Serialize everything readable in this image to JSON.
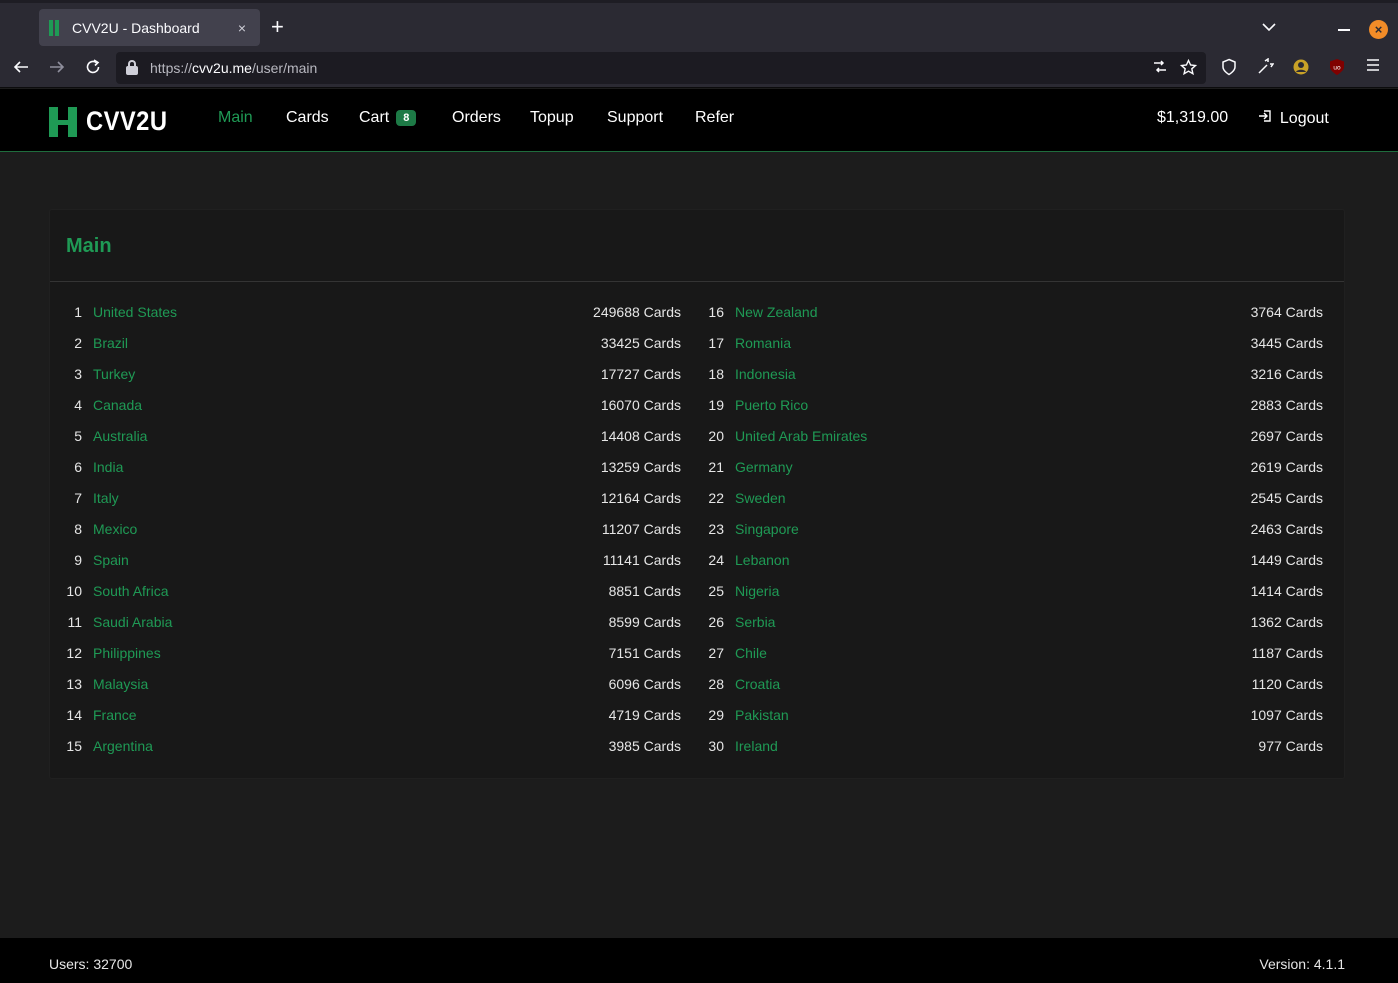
{
  "browser": {
    "tab_title": "CVV2U - Dashboard",
    "tab_close": "×",
    "new_tab": "+",
    "url_prefix": "https://",
    "url_host": "cvv2u.me",
    "url_path": "/user/main",
    "icons": {
      "back": "arrow-left-icon",
      "forward": "arrow-right-icon",
      "reload": "reload-icon",
      "lock": "lock-icon",
      "reader": "reader-mode-icon",
      "bookmark": "star-icon",
      "shield": "shield-icon",
      "extensions": "extension-icon",
      "menu": "hamburger-menu-icon"
    }
  },
  "header": {
    "logo_text": "CVV2U",
    "nav": {
      "main": "Main",
      "cards": "Cards",
      "cart": "Cart",
      "cart_count": "8",
      "orders": "Orders",
      "topup": "Topup",
      "support": "Support",
      "refer": "Refer"
    },
    "balance": "$1,319.00",
    "logout": "Logout",
    "accent_color": "#1f9a55"
  },
  "main": {
    "title": "Main",
    "rows": [
      {
        "rank": "1",
        "country": "United States",
        "count": "249688 Cards"
      },
      {
        "rank": "2",
        "country": "Brazil",
        "count": "33425 Cards"
      },
      {
        "rank": "3",
        "country": "Turkey",
        "count": "17727 Cards"
      },
      {
        "rank": "4",
        "country": "Canada",
        "count": "16070 Cards"
      },
      {
        "rank": "5",
        "country": "Australia",
        "count": "14408 Cards"
      },
      {
        "rank": "6",
        "country": "India",
        "count": "13259 Cards"
      },
      {
        "rank": "7",
        "country": "Italy",
        "count": "12164 Cards"
      },
      {
        "rank": "8",
        "country": "Mexico",
        "count": "11207 Cards"
      },
      {
        "rank": "9",
        "country": "Spain",
        "count": "11141 Cards"
      },
      {
        "rank": "10",
        "country": "South Africa",
        "count": "8851 Cards"
      },
      {
        "rank": "11",
        "country": "Saudi Arabia",
        "count": "8599 Cards"
      },
      {
        "rank": "12",
        "country": "Philippines",
        "count": "7151 Cards"
      },
      {
        "rank": "13",
        "country": "Malaysia",
        "count": "6096 Cards"
      },
      {
        "rank": "14",
        "country": "France",
        "count": "4719 Cards"
      },
      {
        "rank": "15",
        "country": "Argentina",
        "count": "3985 Cards"
      },
      {
        "rank": "16",
        "country": "New Zealand",
        "count": "3764 Cards"
      },
      {
        "rank": "17",
        "country": "Romania",
        "count": "3445 Cards"
      },
      {
        "rank": "18",
        "country": "Indonesia",
        "count": "3216 Cards"
      },
      {
        "rank": "19",
        "country": "Puerto Rico",
        "count": "2883 Cards"
      },
      {
        "rank": "20",
        "country": "United Arab Emirates",
        "count": "2697 Cards"
      },
      {
        "rank": "21",
        "country": "Germany",
        "count": "2619 Cards"
      },
      {
        "rank": "22",
        "country": "Sweden",
        "count": "2545 Cards"
      },
      {
        "rank": "23",
        "country": "Singapore",
        "count": "2463 Cards"
      },
      {
        "rank": "24",
        "country": "Lebanon",
        "count": "1449 Cards"
      },
      {
        "rank": "25",
        "country": "Nigeria",
        "count": "1414 Cards"
      },
      {
        "rank": "26",
        "country": "Serbia",
        "count": "1362 Cards"
      },
      {
        "rank": "27",
        "country": "Chile",
        "count": "1187 Cards"
      },
      {
        "rank": "28",
        "country": "Croatia",
        "count": "1120 Cards"
      },
      {
        "rank": "29",
        "country": "Pakistan",
        "count": "1097 Cards"
      },
      {
        "rank": "30",
        "country": "Ireland",
        "count": "977 Cards"
      }
    ]
  },
  "footer": {
    "users": "Users: 32700",
    "version": "Version: 4.1.1"
  }
}
